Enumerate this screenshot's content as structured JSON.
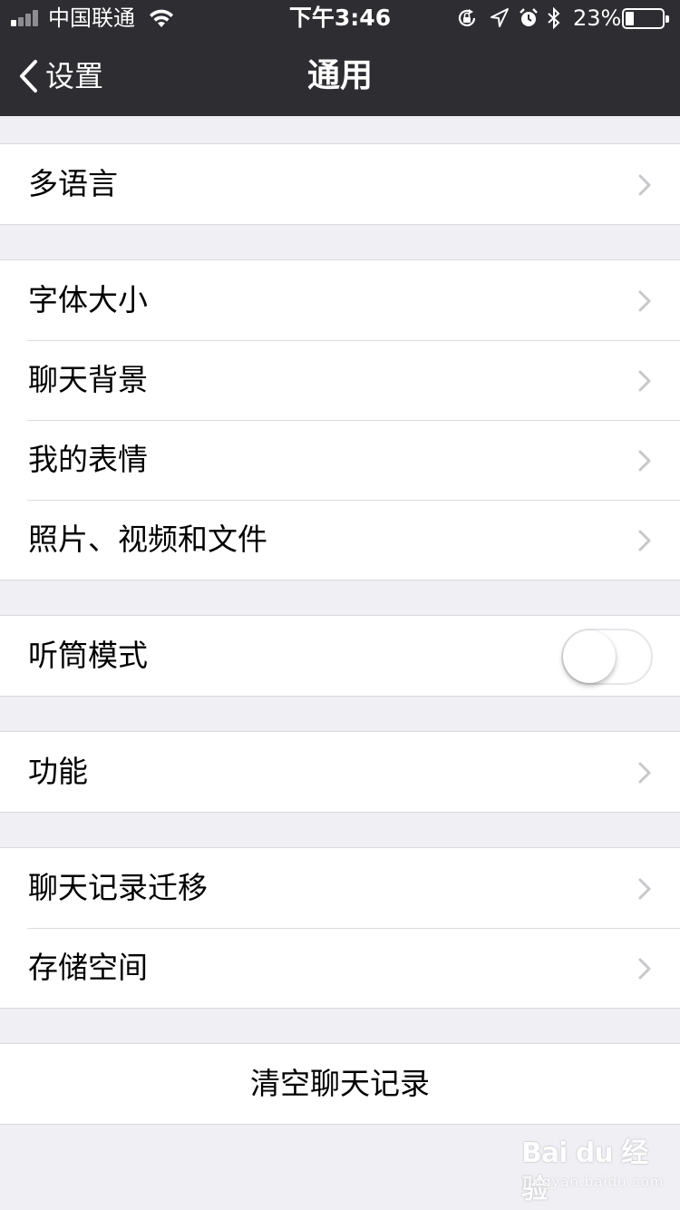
{
  "status_bar": {
    "carrier": "中国联通",
    "time": "下午3:46",
    "battery_percent": "23%",
    "battery_level": 0.23,
    "icons": [
      "signal-icon",
      "wifi-icon",
      "orientation-lock-icon",
      "location-icon",
      "alarm-icon",
      "bluetooth-icon",
      "battery-icon"
    ]
  },
  "nav": {
    "back_label": "设置",
    "title": "通用"
  },
  "groups": [
    {
      "items": [
        {
          "label": "多语言"
        }
      ]
    },
    {
      "items": [
        {
          "label": "字体大小"
        },
        {
          "label": "聊天背景"
        },
        {
          "label": "我的表情"
        },
        {
          "label": "照片、视频和文件"
        }
      ]
    },
    {
      "items": [
        {
          "label": "听筒模式",
          "toggle": false
        }
      ]
    },
    {
      "items": [
        {
          "label": "功能"
        }
      ]
    },
    {
      "items": [
        {
          "label": "聊天记录迁移"
        },
        {
          "label": "存储空间"
        }
      ]
    }
  ],
  "clear_button": {
    "label": "清空聊天记录"
  },
  "watermark": {
    "main": "Bai du 经验",
    "sub": "jingyan.baidu.com"
  },
  "colors": {
    "nav_background": "#2e2d32",
    "page_background": "#efeff4",
    "chevron": "#c7c7cc"
  }
}
